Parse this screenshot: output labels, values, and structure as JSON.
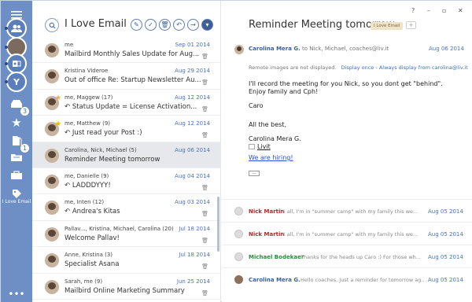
{
  "colors": {
    "sidebar": "#6d8fc5",
    "accent": "#4a72b8",
    "nick_martin": "#b02a2a",
    "michael": "#2e8b3a",
    "carolina": "#3a5ea0",
    "star": "#f2b21c"
  },
  "sidebar": {
    "items": [
      {
        "icon": "hamburger-menu-icon"
      },
      {
        "icon": "contacts-icon"
      },
      {
        "icon": "account-avatar-icon"
      },
      {
        "icon": "outlook-icon"
      },
      {
        "icon": "yahoo-icon"
      },
      {
        "icon": "inbox-icon",
        "badge": "3"
      },
      {
        "icon": "star-icon"
      },
      {
        "icon": "documents-icon",
        "badge": "1"
      },
      {
        "icon": "folder-icon"
      },
      {
        "icon": "briefcase-icon"
      },
      {
        "icon": "tag-icon",
        "label": "I Love Email"
      },
      {
        "icon": "more-icon"
      }
    ]
  },
  "list": {
    "folder_title": "I Love Email",
    "toolbar_icons": [
      "compose-icon",
      "check-icon",
      "delete-icon",
      "reply-icon",
      "forward-icon",
      "dropdown-icon"
    ],
    "messages": [
      {
        "sender": "me",
        "date": "Sep 01 2014",
        "subject": "Mailbird Monthly Sales Update for Aug...",
        "star": false,
        "reply": false
      },
      {
        "sender": "Kristina Videroe",
        "date": "Aug 29 2014",
        "subject": "Out of office Re: Startup Newsletter Au...",
        "star": false,
        "reply": false
      },
      {
        "sender": "me, Maggew (17)",
        "date": "Aug 12 2014",
        "subject": "Status Update = License Activation...",
        "star": true,
        "reply": true
      },
      {
        "sender": "me, Matthew (9)",
        "date": "Aug 12 2014",
        "subject": "Just read your Post :)",
        "star": true,
        "reply": true
      },
      {
        "sender": "Carolina, Nick, Michael (5)",
        "date": "Aug 06 2014",
        "subject": "Reminder Meeting tomorrow",
        "star": false,
        "reply": false,
        "selected": true
      },
      {
        "sender": "me, Danielle (9)",
        "date": "Aug 04 2014",
        "subject": "LADDDYYY!",
        "star": false,
        "reply": true
      },
      {
        "sender": "me, Inten (12)",
        "date": "Aug 03 2014",
        "subject": "Andrea's Kitas",
        "star": false,
        "reply": true
      },
      {
        "sender": "Pallav..., Kristina, Michael, Carolina (20)",
        "date": "Jul 18 2014",
        "subject": "Welcome Pallav!",
        "star": false,
        "reply": false
      },
      {
        "sender": "Anne, Kristina (3)",
        "date": "Jul 18 2014",
        "subject": "Specialist Asana",
        "star": false,
        "reply": false
      },
      {
        "sender": "Sarah, me (9)",
        "date": "Jun 25 2014",
        "subject": "Mailbird Online Marketing Summary",
        "star": false,
        "reply": false
      }
    ]
  },
  "reading": {
    "window_controls": [
      "?",
      "–",
      "▫",
      "✕"
    ],
    "subject": "Reminder Meeting tomorrow",
    "tag": "I Love Email",
    "tag_add": "+",
    "from_name": "Carolina Mera G.",
    "to_line": "to Nick, Michael, coaches@liv.it",
    "date": "Aug 06 2014",
    "notice_text": "Remote images are not displayed.",
    "display_once": "Display once",
    "display_always": "Always display from carolina@liv.it",
    "body": [
      "I'll record the meeting for you Nick, so you dont get \"behind\".",
      "Enjoy family and Cph!",
      "Caro",
      "All the best,",
      "Carolina Mera G.",
      "Livit"
    ],
    "hiring_link": "We are hiring!",
    "thread": [
      {
        "name": "Nick Martin",
        "snippet": "Hi all, I'm in \"summer camp\" with my family this we...",
        "date": "Aug 05 2014"
      },
      {
        "name": "Nick Martin",
        "snippet": "Hi all, I'm in \"summer camp\" with my family this we...",
        "date": "Aug 05 2014"
      },
      {
        "name": "Michael Bodekaer",
        "snippet": "Thanks for the heads up Caro :) For those wh...",
        "date": "Aug 05 2014"
      },
      {
        "name": "Carolina Mera G.",
        "snippet": "Hello coaches, Just a reminder for tomorrow ag...",
        "date": "Aug 05 2014"
      }
    ]
  }
}
